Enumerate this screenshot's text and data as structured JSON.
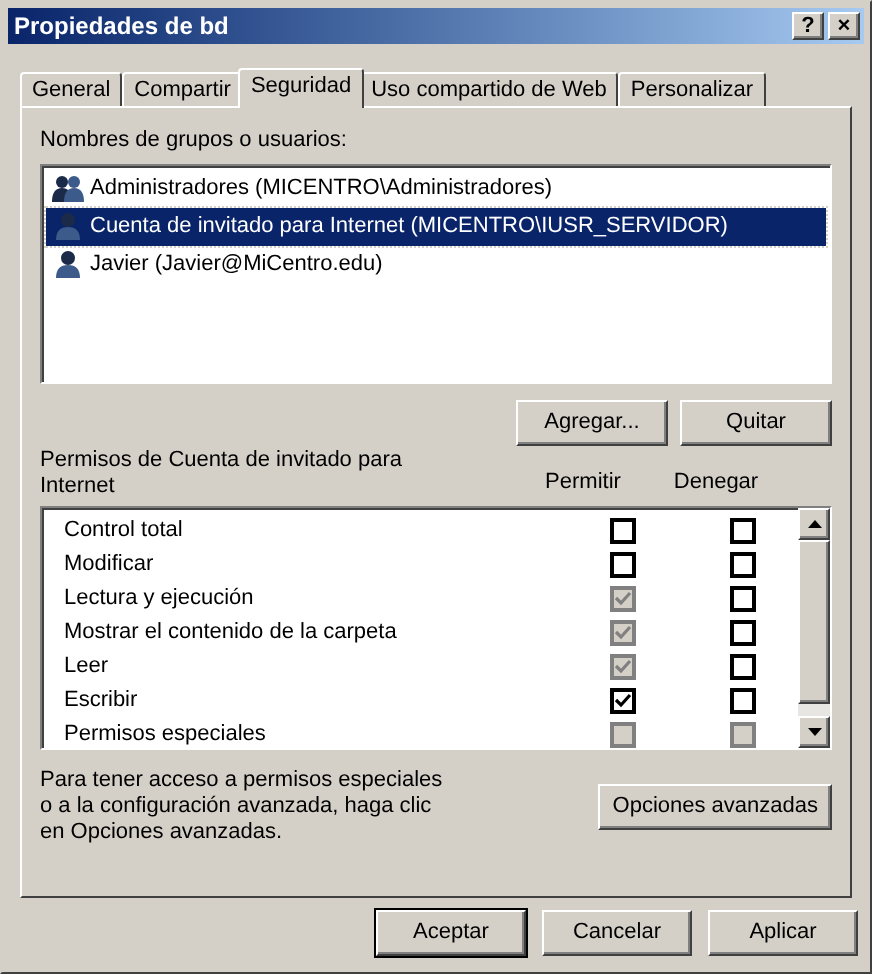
{
  "window": {
    "title": "Propiedades de bd",
    "buttons": [
      "?",
      "×"
    ]
  },
  "tabs": [
    {
      "label": "General",
      "selected": false
    },
    {
      "label": "Compartir",
      "selected": false
    },
    {
      "label": "Seguridad",
      "selected": true
    },
    {
      "label": "Uso compartido de Web",
      "selected": false
    },
    {
      "label": "Personalizar",
      "selected": false
    }
  ],
  "users": {
    "label": "Nombres de grupos o usuarios:",
    "items": [
      {
        "name": "Administradores (MICENTRO\\Administradores)",
        "kind": "group",
        "selected": false
      },
      {
        "name": "Cuenta de invitado para Internet (MICENTRO\\IUSR_SERVIDOR)",
        "kind": "user",
        "selected": true
      },
      {
        "name": "Javier (Javier@MiCentro.edu)",
        "kind": "user",
        "selected": false
      }
    ],
    "buttons": [
      "Agregar...",
      "Quitar"
    ]
  },
  "permissions": {
    "label": "Permisos de Cuenta de invitado para Internet",
    "columns": [
      "Permitir",
      "Denegar"
    ],
    "rows": [
      {
        "name": "Control total",
        "allow": {
          "checked": false,
          "disabled": false
        },
        "deny": {
          "checked": false,
          "disabled": false
        }
      },
      {
        "name": "Modificar",
        "allow": {
          "checked": false,
          "disabled": false
        },
        "deny": {
          "checked": false,
          "disabled": false
        }
      },
      {
        "name": "Lectura y ejecución",
        "allow": {
          "checked": true,
          "disabled": true
        },
        "deny": {
          "checked": false,
          "disabled": false
        }
      },
      {
        "name": "Mostrar el contenido de la carpeta",
        "allow": {
          "checked": true,
          "disabled": true
        },
        "deny": {
          "checked": false,
          "disabled": false
        }
      },
      {
        "name": "Leer",
        "allow": {
          "checked": true,
          "disabled": true
        },
        "deny": {
          "checked": false,
          "disabled": false
        }
      },
      {
        "name": "Escribir",
        "allow": {
          "checked": true,
          "disabled": false
        },
        "deny": {
          "checked": false,
          "disabled": false
        }
      },
      {
        "name": "Permisos especiales",
        "allow": {
          "checked": false,
          "disabled": true
        },
        "deny": {
          "checked": false,
          "disabled": true
        }
      }
    ]
  },
  "advanced": {
    "text": "Para tener acceso a permisos especiales o a la configuración avanzada, haga clic en Opciones avanzadas.",
    "button": "Opciones avanzadas"
  },
  "footer_buttons": [
    {
      "label": "Aceptar",
      "default": true
    },
    {
      "label": "Cancelar",
      "default": false
    },
    {
      "label": "Aplicar",
      "default": false
    }
  ]
}
